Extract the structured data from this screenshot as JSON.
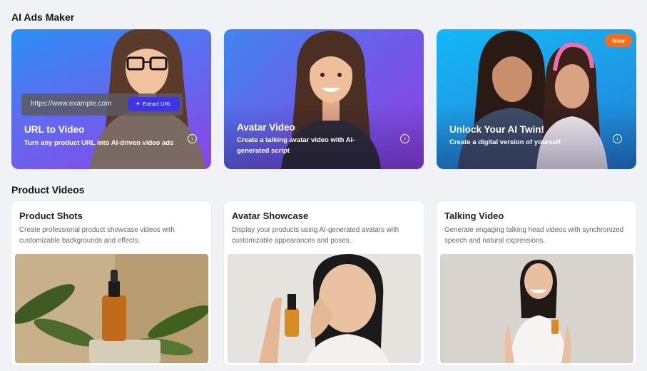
{
  "ai_ads": {
    "title": "AI Ads Maker",
    "cards": [
      {
        "title": "URL to Video",
        "description": "Turn any product URL into AI-driven video ads",
        "url_placeholder": "https://www.example.com",
        "extract_label": "Extract URL",
        "gradient": [
          "#2f8ff2",
          "#8a46e8"
        ]
      },
      {
        "title": "Avatar Video",
        "description": "Create a talking avatar video with AI-generated script",
        "gradient": [
          "#4a7fee",
          "#8f3fe3"
        ]
      },
      {
        "title": "Unlock Your AI Twin!",
        "description": "Create a digital version of yourself",
        "badge": "New",
        "gradient": [
          "#18b4f4",
          "#1f86d8"
        ]
      }
    ]
  },
  "product_videos": {
    "title": "Product Videos",
    "cards": [
      {
        "title": "Product Shots",
        "description": "Create professional product showcase videos with customizable backgrounds and effects."
      },
      {
        "title": "Avatar Showcase",
        "description": "Display your products using AI-generated avatars with customizable appearances and poses."
      },
      {
        "title": "Talking Video",
        "description": "Generate engaging talking head videos with synchronized speech and natural expressions."
      }
    ]
  }
}
